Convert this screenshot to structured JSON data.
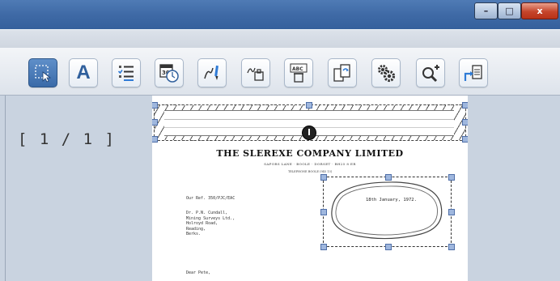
{
  "window": {
    "controls": [
      "minimize-icon",
      "maximize-icon",
      "close-icon"
    ],
    "close_glyph": "x"
  },
  "toolbar": {
    "tools": [
      {
        "name": "select-tool-button",
        "icon": "cursor-select-icon",
        "active": true
      },
      {
        "name": "text-tool-button",
        "icon": "letter-a-icon"
      },
      {
        "name": "checklist-tool-button",
        "icon": "checklist-icon"
      },
      {
        "name": "calendar-clock-tool-button",
        "icon": "calendar-clock-icon"
      },
      {
        "name": "pen-tool-button",
        "icon": "pen-icon"
      },
      {
        "name": "signature-tool-button",
        "icon": "signature-icon"
      },
      {
        "name": "abc-delete-tool-button",
        "icon": "abc-trash-icon"
      },
      {
        "name": "copy-rotate-tool-button",
        "icon": "copy-rotate-icon"
      },
      {
        "name": "settings-tool-button",
        "icon": "gears-icon"
      },
      {
        "name": "zoom-in-tool-button",
        "icon": "zoom-in-icon"
      },
      {
        "name": "export-tool-button",
        "icon": "export-icon"
      }
    ],
    "text_tool_glyph": "A",
    "abc_label": "ABC"
  },
  "sidebar": {
    "page_counter": "[ 1 / 1 ]"
  },
  "document": {
    "company": "THE SLEREXE COMPANY LIMITED",
    "address": "SAPORS LANE · BOOLE · DORSET · BH25 8 ER",
    "telephone": "TELEPHONE BOOLE (945 13)",
    "ref": "Our Ref. 350/PJC/EAC",
    "date": "18th January, 1972.",
    "recipient": [
      "Dr. P.N. Cundall,",
      "Mining Surveys Ltd.,",
      "Holroyd Road,",
      "Reading,",
      "Berks."
    ],
    "greeting": "Dear Pete,"
  },
  "colors": {
    "titlebar": "#3f6aa6",
    "active_tool": "#3a6aa8",
    "panel_bg": "#c9d3e0",
    "handle": "#9fb7de"
  }
}
